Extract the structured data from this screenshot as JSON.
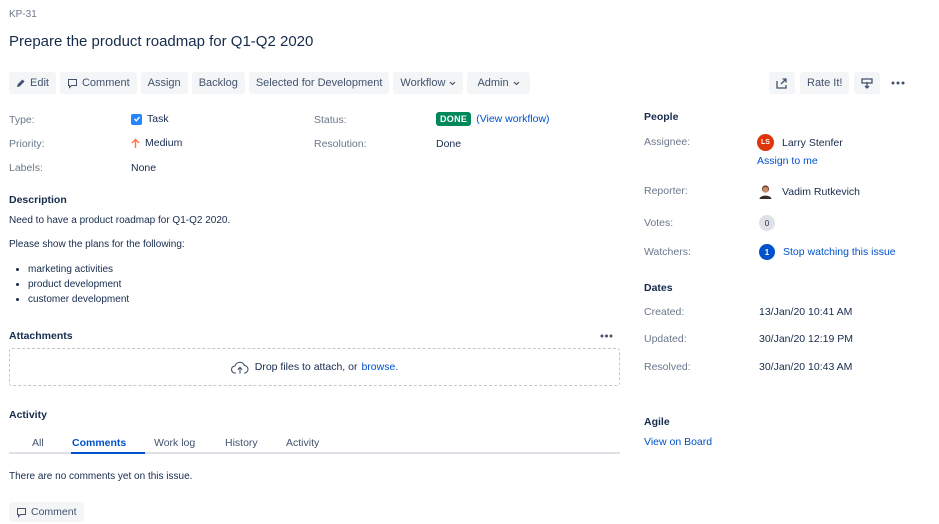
{
  "issue": {
    "key": "KP-31",
    "summary": "Prepare the product roadmap for Q1-Q2 2020"
  },
  "toolbar": {
    "edit": "Edit",
    "comment": "Comment",
    "assign": "Assign",
    "backlog": "Backlog",
    "selected_for_dev": "Selected for Development",
    "workflow": "Workflow",
    "admin": "Admin",
    "rate_it": "Rate It!"
  },
  "details": {
    "type_label": "Type:",
    "type_value": "Task",
    "priority_label": "Priority:",
    "priority_value": "Medium",
    "labels_label": "Labels:",
    "labels_value": "None",
    "status_label": "Status:",
    "status_value": "DONE",
    "view_workflow": "(View workflow)",
    "resolution_label": "Resolution:",
    "resolution_value": "Done"
  },
  "description": {
    "heading": "Description",
    "line1": "Need to have a product roadmap for Q1-Q2 2020.",
    "line2": "Please show the plans for the following:",
    "bullets": [
      "marketing activities",
      "product development",
      "customer development"
    ]
  },
  "attachments": {
    "heading": "Attachments",
    "drop_text": "Drop files to attach, or",
    "browse": "browse."
  },
  "activity": {
    "heading": "Activity",
    "tabs": [
      "All",
      "Comments",
      "Work log",
      "History",
      "Activity"
    ],
    "active_tab": "Comments",
    "empty_text": "There are no comments yet on this issue.",
    "comment_button": "Comment"
  },
  "people": {
    "heading": "People",
    "assignee_label": "Assignee:",
    "assignee_name": "Larry Stenfer",
    "assignee_initials": "LS",
    "assign_to_me": "Assign to me",
    "reporter_label": "Reporter:",
    "reporter_name": "Vadim Rutkevich",
    "votes_label": "Votes:",
    "votes_count": "0",
    "watchers_label": "Watchers:",
    "watchers_count": "1",
    "stop_watching": "Stop watching this issue"
  },
  "dates": {
    "heading": "Dates",
    "created_label": "Created:",
    "created_value": "13/Jan/20 10:41 AM",
    "updated_label": "Updated:",
    "updated_value": "30/Jan/20 12:19 PM",
    "resolved_label": "Resolved:",
    "resolved_value": "30/Jan/20 10:43 AM"
  },
  "agile": {
    "heading": "Agile",
    "view_on_board": "View on Board"
  },
  "colors": {
    "link": "#0052cc",
    "done_lozenge": "#00875a",
    "assignee_avatar": "#de350b",
    "priority_medium": "#ff7452",
    "task_icon": "#2684ff"
  },
  "icons": [
    "pencil-icon",
    "comment-icon",
    "chevron-down-icon",
    "share-icon",
    "export-icon",
    "more-icon",
    "checkbox-icon",
    "arrow-up-icon",
    "cloud-upload-icon"
  ]
}
